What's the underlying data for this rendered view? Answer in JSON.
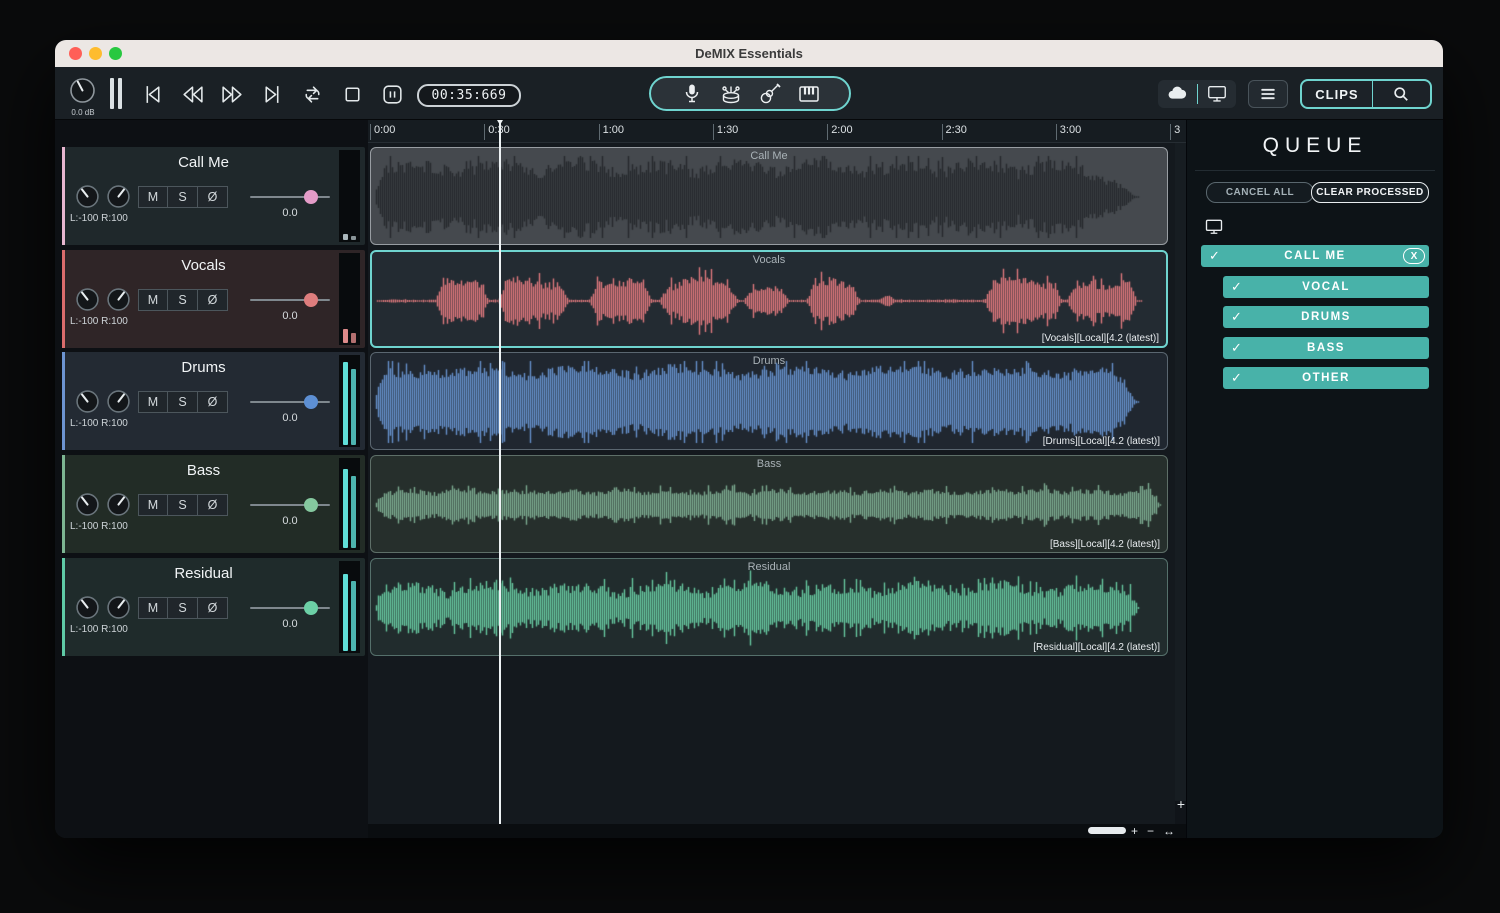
{
  "window": {
    "title": "DeMIX Essentials"
  },
  "colors": {
    "accent": "#6fd4cf",
    "queue_row": "#48b2a9"
  },
  "toolbar": {
    "master_db": "0.0 dB",
    "time": "00:35:669",
    "clips": "CLIPS",
    "transport": [
      "skip-start",
      "rewind",
      "fast-forward",
      "skip-end",
      "loop",
      "stop",
      "pause"
    ],
    "instrument_icons": [
      "microphone",
      "drums",
      "guitar",
      "piano"
    ]
  },
  "timeline": {
    "ticks": [
      "0:00",
      "0:30",
      "1:00",
      "1:30",
      "2:00",
      "2:30",
      "3:00",
      "3"
    ]
  },
  "track_buttons": [
    "M",
    "S",
    "Ø"
  ],
  "tracks": [
    {
      "name": "Call Me",
      "pan_label": "L:-100 R:100",
      "volume": "0.0",
      "clip_label": "Call Me",
      "clip_tag": "",
      "selected": false,
      "colors": {
        "stripe": "#e7b6d0",
        "header_bg": "#1f282b",
        "handle": "#e49cc8",
        "clip_bg": "#45494e",
        "wave": "#26292d",
        "clip_border": "#989da2",
        "meter": "#aab7bc"
      },
      "meter_levels": [
        0.07,
        0.05
      ],
      "wave": {
        "seed": 3,
        "amp": 0.95,
        "flat": 0.42,
        "macroFreq": 31,
        "segments": [
          [
            0,
            0.968,
            1
          ]
        ],
        "fade": [
          0.9,
          0.968
        ]
      }
    },
    {
      "name": "Vocals",
      "pan_label": "L:-100 R:100",
      "volume": "0.0",
      "clip_label": "Vocals",
      "clip_tag": "[Vocals][Local][4.2 (latest)]",
      "selected": true,
      "colors": {
        "stripe": "#da6c6c",
        "header_bg": "#2f2527",
        "handle": "#de7d7d",
        "clip_bg": "#232b32",
        "wave": "#e0797d",
        "clip_border": "#6fd4cf",
        "meter": "#de8a8a"
      },
      "meter_levels": [
        0.16,
        0.11
      ],
      "wave": {
        "seed": 7,
        "amp": 0.62,
        "flat": 0.38,
        "macroFreq": 40,
        "segments": [
          [
            0,
            0.97,
            0.06
          ],
          [
            0.075,
            0.145,
            0.95
          ],
          [
            0.155,
            0.245,
            1
          ],
          [
            0.27,
            0.35,
            0.95
          ],
          [
            0.36,
            0.46,
            1
          ],
          [
            0.465,
            0.525,
            0.6
          ],
          [
            0.545,
            0.615,
            0.9
          ],
          [
            0.635,
            0.66,
            0.3
          ],
          [
            0.77,
            0.87,
            0.95
          ],
          [
            0.875,
            0.965,
            0.9
          ]
        ]
      }
    },
    {
      "name": "Drums",
      "pan_label": "L:-100 R:100",
      "volume": "0.0",
      "clip_label": "Drums",
      "clip_tag": "[Drums][Local][4.2 (latest)]",
      "selected": false,
      "colors": {
        "stripe": "#6d94d1",
        "header_bg": "#232a33",
        "handle": "#5d8fd3",
        "clip_bg": "#202730",
        "wave": "#6691cc",
        "clip_border": "#5a6670",
        "meter": "#5fdfd8"
      },
      "meter_levels": [
        0.94,
        0.86
      ],
      "wave": {
        "seed": 5,
        "amp": 0.9,
        "flat": 0.55,
        "macroFreq": 23,
        "segments": [
          [
            0,
            0.968,
            1
          ]
        ],
        "fade": [
          0.93,
          0.968
        ]
      }
    },
    {
      "name": "Bass",
      "pan_label": "L:-100 R:100",
      "volume": "0.0",
      "clip_label": "Bass",
      "clip_tag": "[Bass][Local][4.2 (latest)]",
      "selected": false,
      "colors": {
        "stripe": "#7db592",
        "header_bg": "#222c26",
        "handle": "#85c89f",
        "clip_bg": "#262f2c",
        "wave": "#7dac91",
        "clip_border": "#5e6f68",
        "meter": "#5fdfd8"
      },
      "meter_levels": [
        0.9,
        0.82
      ],
      "wave": {
        "seed": 9,
        "amp": 0.4,
        "flat": 0.5,
        "macroFreq": 47,
        "segments": [
          [
            0,
            0.995,
            1
          ]
        ]
      }
    },
    {
      "name": "Residual",
      "pan_label": "L:-100 R:100",
      "volume": "0.0",
      "clip_label": "Residual",
      "clip_tag": "[Residual][Local][4.2 (latest)]",
      "selected": false,
      "colors": {
        "stripe": "#5fcaa6",
        "header_bg": "#1f2b2b",
        "handle": "#6cd0a6",
        "clip_bg": "#212c2d",
        "wave": "#67c9a0",
        "clip_border": "#55706b",
        "meter": "#5fdfd8"
      },
      "meter_levels": [
        0.87,
        0.79
      ],
      "wave": {
        "seed": 13,
        "amp": 0.68,
        "flat": 0.3,
        "macroFreq": 29,
        "segments": [
          [
            0,
            0.968,
            1
          ]
        ]
      }
    }
  ],
  "queue": {
    "title": "QUEUE",
    "cancel_all": "CANCEL ALL",
    "clear_processed": "CLEAR PROCESSED",
    "check": "✓",
    "job": {
      "label": "CALL ME",
      "close": "X",
      "stems": [
        "VOCAL",
        "DRUMS",
        "BASS",
        "OTHER"
      ]
    }
  },
  "scroll": {
    "zoom_in": "+",
    "zoom_out": "−",
    "fit": "↔"
  }
}
